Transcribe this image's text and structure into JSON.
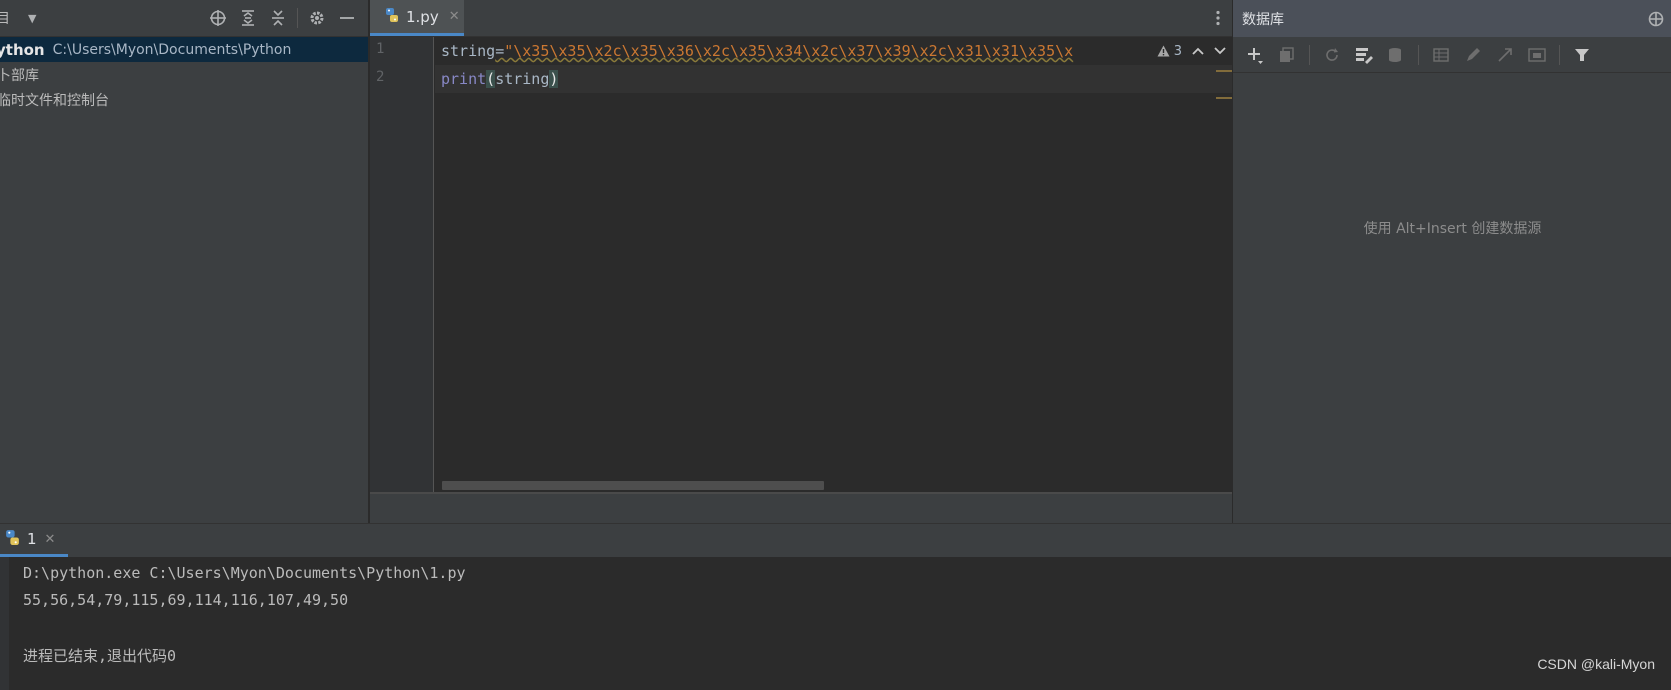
{
  "project": {
    "title": "目",
    "root_name": "ython",
    "root_path": "C:\\Users\\Myon\\Documents\\Python",
    "items": [
      {
        "label": "卜部库"
      },
      {
        "label": "临时文件和控制台"
      }
    ]
  },
  "editor": {
    "tab_label": "1.py",
    "line_numbers": [
      "1",
      "2"
    ],
    "line1": {
      "ident": "string",
      "eq": "=",
      "string": "\"\\x35\\x35\\x2c\\x35\\x36\\x2c\\x35\\x34\\x2c\\x37\\x39\\x2c\\x31\\x31\\x35\\x"
    },
    "line2": {
      "builtin": "print",
      "open": "(",
      "arg": "string",
      "close": ")"
    },
    "warning_count": "3"
  },
  "database": {
    "title": "数据库",
    "empty_text": "使用 Alt+Insert 创建数据源"
  },
  "run": {
    "tab_label": "1",
    "output_lines": [
      "D:\\python.exe C:\\Users\\Myon\\Documents\\Python\\1.py",
      "55,56,54,79,115,69,114,116,107,49,50",
      "",
      "进程已结束,退出代码0"
    ]
  },
  "watermark": "CSDN @kali-Myon",
  "colors": {
    "accent": "#4a88c7",
    "string": "#cc7832",
    "builtin": "#8888c6",
    "background": "#2b2b2b",
    "panel": "#3c3f41"
  }
}
